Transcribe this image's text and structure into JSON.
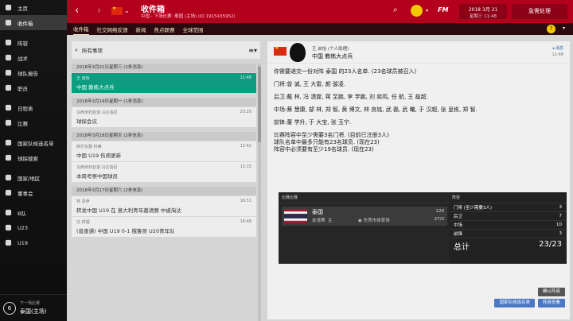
{
  "sidebar": {
    "items": [
      {
        "label": "主页",
        "icon": "home-icon"
      },
      {
        "label": "收件箱",
        "icon": "mail-icon",
        "active": true
      },
      {
        "label": "阵容",
        "icon": "people-icon"
      },
      {
        "label": "战术",
        "icon": "tactics-icon"
      },
      {
        "label": "球队报告",
        "icon": "report-icon"
      },
      {
        "label": "职员",
        "icon": "staff-icon"
      },
      {
        "label": "日程表",
        "icon": "calendar-icon"
      },
      {
        "label": "比赛",
        "icon": "match-icon"
      },
      {
        "label": "国家队候选名单",
        "icon": "shortlist-icon"
      },
      {
        "label": "球探搜索",
        "icon": "scout-icon"
      },
      {
        "label": "国家/地区",
        "icon": "nation-icon"
      },
      {
        "label": "董事会",
        "icon": "board-icon"
      },
      {
        "label": "B队",
        "icon": "b-team-icon"
      },
      {
        "label": "U23",
        "icon": "u23-icon"
      },
      {
        "label": "U19",
        "icon": "u19-icon"
      }
    ],
    "footer": {
      "small": "下一场比赛",
      "big": "泰国(主场)",
      "level": "6"
    }
  },
  "header": {
    "title": "收件箱",
    "subtitle": "中国 - 下场比赛: 泰国 (主场) (ID 1915435952)",
    "date_line1": "2018 3月 21",
    "date_line2": "星期三 11:48",
    "continue": "急需处理",
    "fm": "FM"
  },
  "tabs": [
    "收件箱",
    "社交网络反馈",
    "新闻",
    "焦点联赛",
    "全球范围"
  ],
  "list": {
    "filter": "所有事项",
    "groups": [
      {
        "label": "2018年3月21日星期三 (1条消息)",
        "messages": [
          {
            "from": "王 启怡",
            "subject": "中国 教练大点兵",
            "time": "11:48",
            "selected": true
          }
        ]
      },
      {
        "label": "2018年3月19日星期一 (1条消息)",
        "messages": [
          {
            "from": "马西米利亚诺·马达洛尼",
            "subject": "球探会议",
            "time": "23:29"
          }
        ]
      },
      {
        "label": "2018年3月18日星期天 (2条信息)",
        "messages": [
          {
            "from": "西尔瓦蒙·科蒂",
            "subject": "中国 U19 伤病更新",
            "time": "12:42"
          },
          {
            "from": "马西米利亚诺·马达洛尼",
            "subject": "本周考察中国球员",
            "time": "12:15"
          }
        ]
      },
      {
        "label": "2018年3月17日星期六 (2条信息)",
        "messages": [
          {
            "from": "林 贵伊",
            "subject": "转发中国 U19 在 意大利青年邀请赛 中被淘汰",
            "time": "16:51"
          },
          {
            "from": "沈 祥福",
            "subject": "(普查通) 中国 U19 0-1 俄鲁贾 U20青年队",
            "time": "16:48"
          }
        ]
      }
    ]
  },
  "message": {
    "sender": "王 启怡 (个人助理)",
    "subject": "中国 教练大点兵",
    "tag": "消息",
    "time": "11:48",
    "lines": [
      "你需要递交一份对阵 泰国 的23人名单. (23名球员被召入)",
      "门将:曾 诚, 王 大雷, 颜 骏凌.",
      "后卫:戴 林, 冯 潇霆, 蒋 至鹏, 李 学鹏, 刘 奕鸣, 任 航, 王 燊超.",
      "中场:蔡 慧康, 郜 林, 郑 智, 黄 博文, 林 良铭, 武 磊, 武 曦, 于 汉超, 张 呈栋, 郑 智.",
      "前锋:董 学升, 于 大宝, 张 玉宁."
    ],
    "rules": [
      "比赛阵容中至少需要3名门将. (目前已注册3人)",
      "球队名单中最多只能有23名球员. (现在23)",
      "阵容中必须要有至少19名球员. (现在23)"
    ]
  },
  "match_card": {
    "header": "比赛比赛",
    "opponent": "泰国",
    "type": "友谊赛",
    "home": "主",
    "venue": "东莞市体育场",
    "num1": "120",
    "num2": "27/3"
  },
  "squad_card": {
    "header": "阵容",
    "rows": [
      {
        "label": "门将 (至少需要3人)",
        "value": "3"
      },
      {
        "label": "后卫",
        "value": "7"
      },
      {
        "label": "中场",
        "value": "10"
      },
      {
        "label": "前锋",
        "value": "3"
      }
    ],
    "total_label": "总计",
    "total_value": "23/23"
  },
  "buttons": {
    "confirm": "确认阵容",
    "edit": "国家队候选名单",
    "squad": "阵容查看"
  },
  "colors": {
    "header_red": "#b3001d",
    "selected_green": "#0d9c7f",
    "link_blue": "#4a78c4"
  }
}
